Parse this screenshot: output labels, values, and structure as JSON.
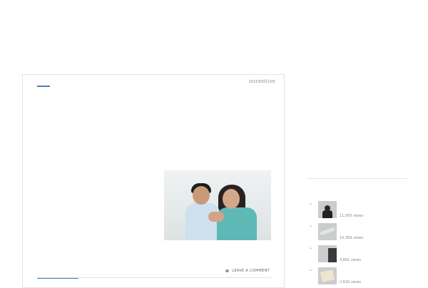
{
  "site": {
    "title": "",
    "tagline": ""
  },
  "nav": {
    "items": [
      "",
      "",
      "",
      "",
      "",
      "",
      ""
    ]
  },
  "article": {
    "category": "",
    "date": "2015年6月23日",
    "title": "",
    "subheading": "",
    "paragraphs": [
      "",
      "",
      ""
    ],
    "photo": "couple-holding-hands-photo",
    "tags_tab": "",
    "comment_link": "LEAVE A COMMENT"
  },
  "sidebar": {
    "popular_label": "",
    "items": [
      {
        "title": "",
        "views": "11,005 views",
        "thumb": "businesswoman-thumb"
      },
      {
        "title": "",
        "views": "10,369 views",
        "thumb": "wave-thumb"
      },
      {
        "title": "",
        "views": "3,891 views",
        "thumb": "office-thumb"
      },
      {
        "title": "",
        "views": "2,620 views",
        "thumb": "documents-thumb"
      }
    ]
  },
  "colors": {
    "accent": "#4a7fb5",
    "link": "#3a6ea5",
    "border": "#e3e3e3"
  }
}
